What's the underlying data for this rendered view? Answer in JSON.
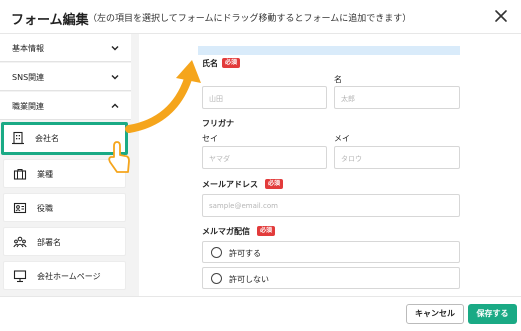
{
  "header": {
    "title": "フォーム編集",
    "subtitle": "（左の項目を選択してフォームにドラッグ移動するとフォームに追加できます）"
  },
  "sidebar": {
    "sections": [
      {
        "label": "基本情報",
        "expanded": false
      },
      {
        "label": "SNS関連",
        "expanded": false
      },
      {
        "label": "職業関連",
        "expanded": true
      }
    ],
    "items": [
      {
        "label": "会社名",
        "icon": "building-icon",
        "selected": true
      },
      {
        "label": "業種",
        "icon": "briefcase-icon",
        "selected": false
      },
      {
        "label": "役職",
        "icon": "id-card-icon",
        "selected": false
      },
      {
        "label": "部署名",
        "icon": "group-icon",
        "selected": false
      },
      {
        "label": "会社ホームページ",
        "icon": "monitor-icon",
        "selected": false
      }
    ]
  },
  "form": {
    "name": {
      "label": "氏名",
      "required": "必須",
      "sub1": "",
      "sub2": "名",
      "ph1": "山田",
      "ph2": "太郎"
    },
    "kana": {
      "label": "フリガナ",
      "sub1": "セイ",
      "sub2": "メイ",
      "ph1": "ヤマダ",
      "ph2": "タロウ"
    },
    "email": {
      "label": "メールアドレス",
      "required": "必須",
      "placeholder": "sample@email.com"
    },
    "newsletter": {
      "label": "メルマガ配信",
      "required": "必須",
      "options": [
        "許可する",
        "許可しない"
      ]
    }
  },
  "footer": {
    "cancel_label": "キャンセル",
    "save_label": "保存する"
  },
  "colors": {
    "accent": "#1aaa85",
    "required": "#e23b3b",
    "arrow": "#f5a51c",
    "drop_zone": "#d9ebfa"
  }
}
